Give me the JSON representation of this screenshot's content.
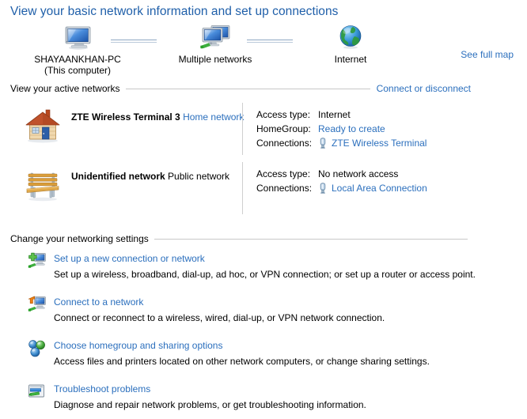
{
  "page": {
    "title": "View your basic network information and set up connections"
  },
  "network_map": {
    "see_full_map": "See full map",
    "nodes": [
      {
        "icon": "computer-icon",
        "label": "SHAYAANKHAN-PC",
        "sublabel": "(This computer)"
      },
      {
        "icon": "multiple-networks-icon",
        "label": "Multiple networks",
        "sublabel": ""
      },
      {
        "icon": "globe-internet-icon",
        "label": "Internet",
        "sublabel": ""
      }
    ]
  },
  "active_networks": {
    "heading": "View your active networks",
    "action_link": "Connect or disconnect",
    "rows": [
      {
        "icon": "house-icon",
        "name": "ZTE Wireless Terminal  3",
        "type": "Home network",
        "details": [
          {
            "key": "Access type:",
            "value": "Internet",
            "is_link": false,
            "has_plug_icon": false
          },
          {
            "key": "HomeGroup:",
            "value": "Ready to create",
            "is_link": true,
            "has_plug_icon": false
          },
          {
            "key": "Connections:",
            "value": "ZTE Wireless Terminal",
            "is_link": true,
            "has_plug_icon": true
          }
        ]
      },
      {
        "icon": "bench-icon",
        "name": "Unidentified network",
        "type": "Public network",
        "details": [
          {
            "key": "Access type:",
            "value": "No network access",
            "is_link": false,
            "has_plug_icon": false
          },
          {
            "key": "Connections:",
            "value": "Local Area Connection",
            "is_link": true,
            "has_plug_icon": true
          }
        ]
      }
    ]
  },
  "settings": {
    "heading": "Change your networking settings",
    "items": [
      {
        "icon": "new-connection-icon",
        "link": "Set up a new connection or network",
        "description": "Set up a wireless, broadband, dial-up, ad hoc, or VPN connection; or set up a router or access point."
      },
      {
        "icon": "connect-network-icon",
        "link": "Connect to a network",
        "description": "Connect or reconnect to a wireless, wired, dial-up, or VPN network connection."
      },
      {
        "icon": "homegroup-icon",
        "link": "Choose homegroup and sharing options",
        "description": "Access files and printers located on other network computers, or change sharing settings."
      },
      {
        "icon": "troubleshoot-icon",
        "link": "Troubleshoot problems",
        "description": "Diagnose and repair network problems, or get troubleshooting information."
      }
    ]
  },
  "colors": {
    "title_blue": "#1f5fa9",
    "link_blue": "#2b6fbd",
    "rule_gray": "#c8c8c8",
    "divider_gray": "#cfcfcf",
    "background": "#ffffff"
  }
}
